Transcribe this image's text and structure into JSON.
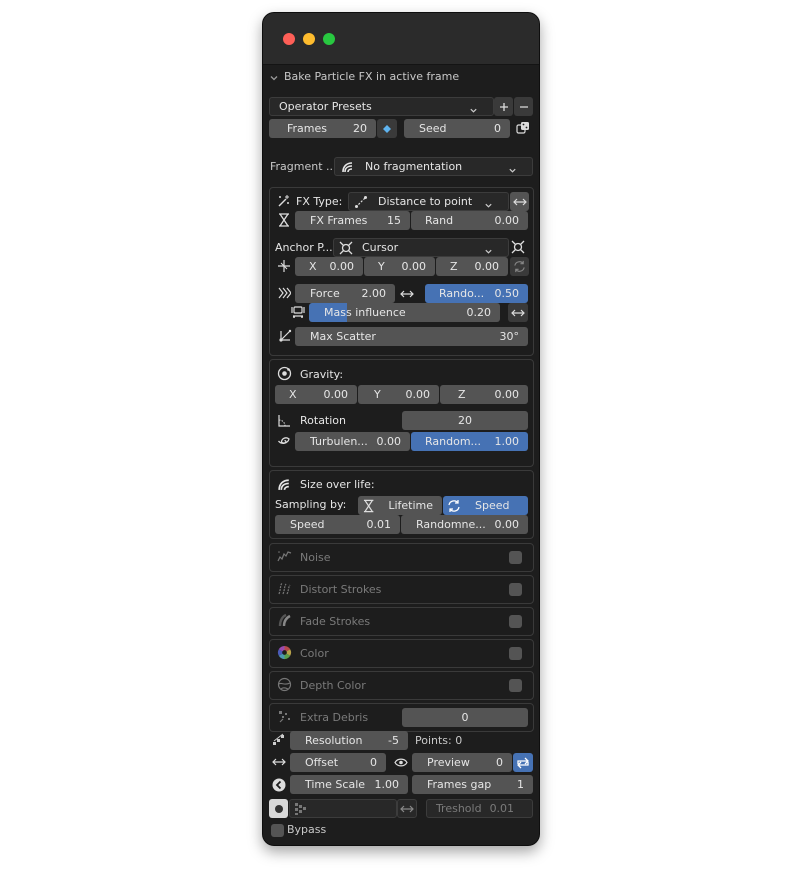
{
  "window": {
    "traffic_lights": [
      "close",
      "minimize",
      "zoom"
    ]
  },
  "panel": {
    "title": "Bake Particle FX in active frame"
  },
  "presets": {
    "label": "Operator Presets",
    "add_icon": "plus-icon",
    "remove_icon": "minus-icon"
  },
  "frames": {
    "label": "Frames",
    "value": "20"
  },
  "seed": {
    "label": "Seed",
    "value": "0"
  },
  "fragment": {
    "label": "Fragment ...",
    "value": "No fragmentation"
  },
  "fx": {
    "type_label": "FX Type:",
    "type_value": "Distance to point",
    "frames_label": "FX Frames",
    "frames_value": "15",
    "rand_label": "Rand",
    "rand_value": "0.00",
    "anchor_label": "Anchor P...",
    "anchor_value": "Cursor",
    "x_label": "X",
    "x_value": "0.00",
    "y_label": "Y",
    "y_value": "0.00",
    "z_label": "Z",
    "z_value": "0.00",
    "force_label": "Force",
    "force_value": "2.00",
    "random_label": "Rando...",
    "random_value": "0.50",
    "mass_label": "Mass influence",
    "mass_value": "0.20",
    "scatter_label": "Max Scatter",
    "scatter_value": "30°"
  },
  "gravity": {
    "title": "Gravity:",
    "x_label": "X",
    "x_value": "0.00",
    "y_label": "Y",
    "y_value": "0.00",
    "z_label": "Z",
    "z_value": "0.00",
    "rotation_label": "Rotation",
    "rotation_value": "20",
    "turb_label": "Turbulen...",
    "turb_value": "0.00",
    "random_label": "Random...",
    "random_value": "1.00"
  },
  "size": {
    "title": "Size over life:",
    "sampling_label": "Sampling by:",
    "lifetime_label": "Lifetime",
    "speed_option_label": "Speed",
    "speed_label": "Speed",
    "speed_value": "0.01",
    "random_label": "Randomne...",
    "random_value": "0.00"
  },
  "toggles": [
    {
      "label": "Noise",
      "icon": "noise-icon"
    },
    {
      "label": "Distort Strokes",
      "icon": "distort-strokes-icon"
    },
    {
      "label": "Fade Strokes",
      "icon": "fade-strokes-icon"
    },
    {
      "label": "Color",
      "icon": "color-wheel-icon"
    },
    {
      "label": "Depth Color",
      "icon": "depth-color-icon"
    }
  ],
  "debris": {
    "label": "Extra Debris",
    "value": "0"
  },
  "footer": {
    "resolution_label": "Resolution",
    "resolution_value": "-5",
    "points_text": "Points: 0",
    "offset_label": "Offset",
    "offset_value": "0",
    "preview_label": "Preview",
    "preview_value": "0",
    "timescale_label": "Time Scale",
    "timescale_value": "1.00",
    "framesgap_label": "Frames gap",
    "framesgap_value": "1",
    "treshold_label": "Treshold",
    "treshold_value": "0.01",
    "bypass_label": "Bypass"
  },
  "colors": {
    "accent": "#4672b4",
    "field": "#545454",
    "panel": "#1d1d1d",
    "titlebar": "#2b2b2b"
  }
}
